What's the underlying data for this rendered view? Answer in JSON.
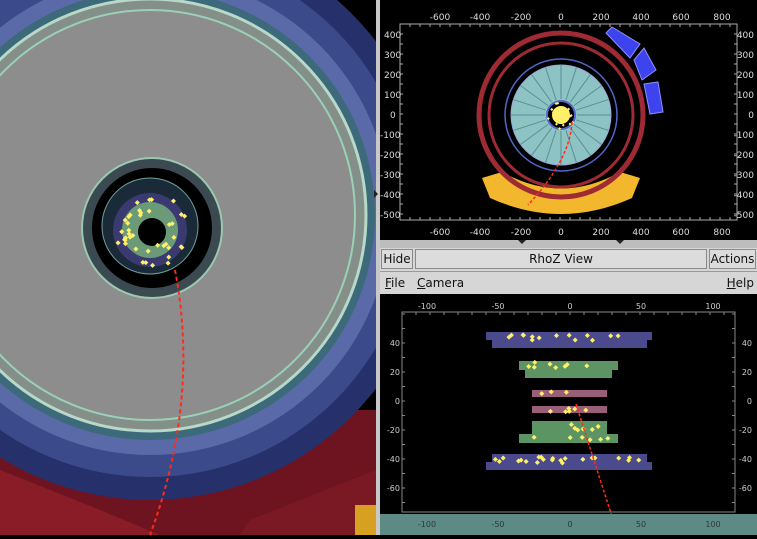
{
  "views": {
    "rhophi": {
      "x_ticks_top": [
        "-600",
        "-400",
        "-200",
        "0",
        "200",
        "400",
        "600",
        "800"
      ],
      "x_ticks_bottom": [
        "-600",
        "-400",
        "-200",
        "0",
        "200",
        "400",
        "600",
        "800"
      ],
      "y_ticks_left": [
        "400",
        "300",
        "200",
        "100",
        "0",
        "-100",
        "-200",
        "-300",
        "-400",
        "-500"
      ],
      "y_ticks_right": [
        "400",
        "300",
        "200",
        "100",
        "0",
        "-100",
        "-200",
        "-300",
        "-400",
        "-500"
      ]
    },
    "rhoz": {
      "title": "RhoZ View",
      "hide_label": "Hide",
      "actions_label": "Actions",
      "menu": {
        "file": {
          "key": "F",
          "rest": "ile"
        },
        "camera": {
          "key": "C",
          "rest": "amera"
        },
        "help": {
          "key": "H",
          "rest": "elp"
        }
      },
      "x_ticks_top": [
        "-100",
        "-50",
        "0",
        "50",
        "100"
      ],
      "x_ticks_bottom": [
        "-100",
        "-50",
        "0",
        "50",
        "100"
      ],
      "y_ticks_left": [
        "40",
        "20",
        "0",
        "-20",
        "-40",
        "-60"
      ],
      "y_ticks_right": [
        "40",
        "20",
        "0",
        "-20",
        "-40",
        "-60"
      ]
    }
  },
  "colors": {
    "ecal_ring": "#9e2a34",
    "tracker_blue": "#5266c8",
    "calo_endcap": "#f2b72c",
    "muon_blue": "#3d44ee",
    "hit_yellow": "#fff06a",
    "track_red": "#ff2a1a",
    "layer_purple": "#4a4a8c",
    "layer_green": "#5c9463",
    "layer_pink": "#9a5f78"
  }
}
